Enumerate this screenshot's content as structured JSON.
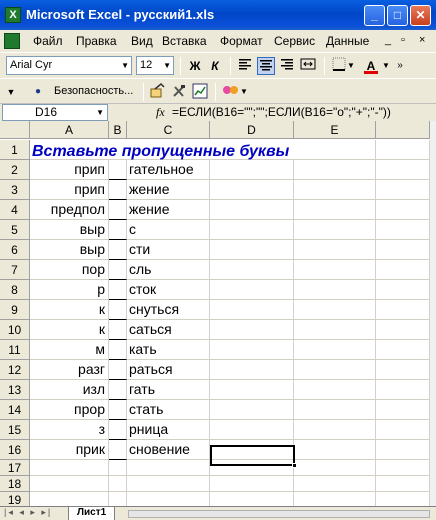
{
  "window": {
    "title": "Microsoft Excel - русский1.xls",
    "app_icon_letter": "X",
    "controls": {
      "minimize": "_",
      "maximize": "□",
      "close": "✕"
    }
  },
  "menubar": {
    "items": [
      "Файл",
      "Правка",
      "Вид",
      "Вставка",
      "Формат",
      "Сервис",
      "Данные"
    ],
    "doc_controls": {
      "minimize": "_",
      "restore": "▫",
      "close": "×"
    }
  },
  "toolbar_format": {
    "font_name": "Arial Cyr",
    "font_size": "12",
    "bold": "Ж",
    "italic": "К",
    "font_color": "A",
    "accent_color": "#e00000"
  },
  "toolbar_security": {
    "security_label": "Безопасность..."
  },
  "formula_bar": {
    "name_box": "D16",
    "fx": "fx",
    "formula": "=ЕСЛИ(B16=\"\";\"\";ЕСЛИ(B16=\"о\";\"+\";\"-\"))"
  },
  "sheet": {
    "columns": [
      "A",
      "B",
      "C",
      "D",
      "E"
    ],
    "row_numbers": [
      "1",
      "2",
      "3",
      "4",
      "5",
      "6",
      "7",
      "8",
      "9",
      "10",
      "11",
      "12",
      "13",
      "14",
      "15",
      "16",
      "17",
      "18",
      "19"
    ],
    "heading": "Вставьте пропущенные буквы",
    "heading_color": "#0000c0",
    "rows": [
      {
        "a": "прип",
        "c": "гательное"
      },
      {
        "a": "прип",
        "c": "жение"
      },
      {
        "a": "предпол",
        "c": "жение"
      },
      {
        "a": "выр",
        "c": "с"
      },
      {
        "a": "выр",
        "c": "сти"
      },
      {
        "a": "пор",
        "c": "сль"
      },
      {
        "a": "р",
        "c": "сток"
      },
      {
        "a": "к",
        "c": "снуться"
      },
      {
        "a": "к",
        "c": "саться"
      },
      {
        "a": "м",
        "c": "кать"
      },
      {
        "a": "разг",
        "c": "раться"
      },
      {
        "a": "изл",
        "c": "гать"
      },
      {
        "a": "прор",
        "c": "стать"
      },
      {
        "a": "з",
        "c": "рница"
      },
      {
        "a": "прик",
        "c": "сновение"
      }
    ],
    "active_cell": "D16"
  },
  "tabs": {
    "sheet1": "Лист1"
  }
}
